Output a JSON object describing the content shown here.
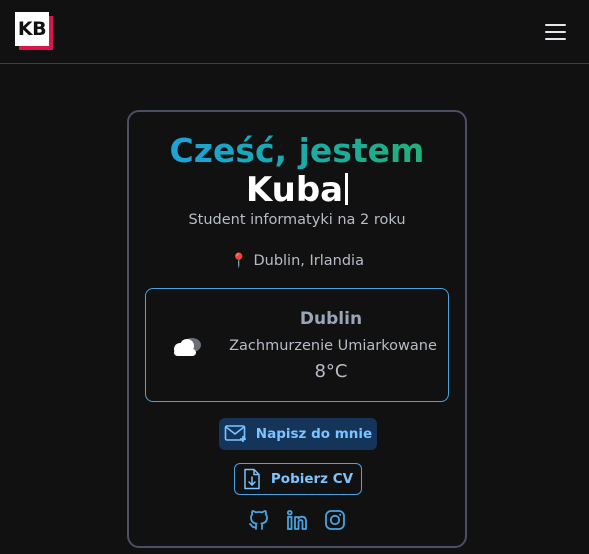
{
  "navbar": {
    "logo_text": "KB",
    "menu_icon": "hamburger-menu-icon"
  },
  "hero": {
    "greeting": "Cześć, jestem",
    "name": "Kuba",
    "subtitle": "Student informatyki na 2 roku",
    "location_icon": "pin-icon",
    "location": "Dublin, Irlandia"
  },
  "weather": {
    "icon": "cloud-icon",
    "city": "Dublin",
    "description": "Zachmurzenie Umiarkowane",
    "temperature": "8°C"
  },
  "actions": {
    "contact_label": "Napisz do mnie",
    "contact_icon": "mail-plus-icon",
    "cv_label": "Pobierz CV",
    "cv_icon": "file-download-icon"
  },
  "socials": [
    {
      "icon": "github-icon"
    },
    {
      "icon": "linkedin-icon"
    },
    {
      "icon": "instagram-icon"
    }
  ],
  "colors": {
    "background": "#111111",
    "accent_blue": "#4aa3e0",
    "button_text": "#7cc3ff",
    "logo_red": "#d6174b",
    "gradient_start": "#1ea0ea",
    "gradient_end": "#23b26a"
  }
}
